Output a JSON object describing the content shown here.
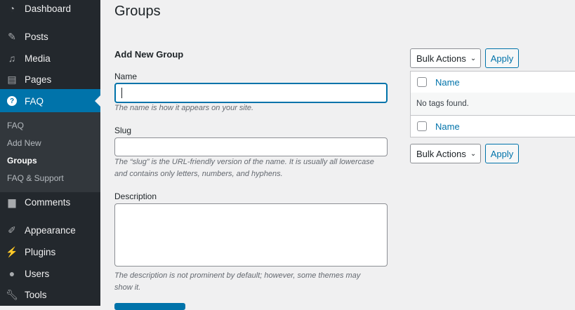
{
  "sidebar": {
    "items": [
      {
        "label": "Dashboard",
        "icon": "dashboard-icon"
      },
      {
        "label": "Posts",
        "icon": "pin-icon"
      },
      {
        "label": "Media",
        "icon": "media-icon"
      },
      {
        "label": "Pages",
        "icon": "pages-icon"
      },
      {
        "label": "FAQ",
        "icon": "help-icon"
      },
      {
        "label": "Comments",
        "icon": "comment-icon"
      },
      {
        "label": "Appearance",
        "icon": "brush-icon"
      },
      {
        "label": "Plugins",
        "icon": "plugin-icon"
      },
      {
        "label": "Users",
        "icon": "user-icon"
      },
      {
        "label": "Tools",
        "icon": "wrench-icon"
      }
    ],
    "submenu": [
      "FAQ",
      "Add New",
      "Groups",
      "FAQ & Support"
    ]
  },
  "page": {
    "title": "Groups"
  },
  "form": {
    "heading": "Add New Group",
    "name_label": "Name",
    "name_value": "",
    "name_help": "The name is how it appears on your site.",
    "slug_label": "Slug",
    "slug_value": "",
    "slug_help": "The “slug” is the URL-friendly version of the name. It is usually all lowercase and contains only letters, numbers, and hyphens.",
    "desc_label": "Description",
    "desc_value": "",
    "desc_help": "The description is not prominent by default; however, some themes may show it."
  },
  "table": {
    "bulk_label": "Bulk Actions",
    "apply_label": "Apply",
    "col_name": "Name",
    "empty": "No tags found."
  }
}
